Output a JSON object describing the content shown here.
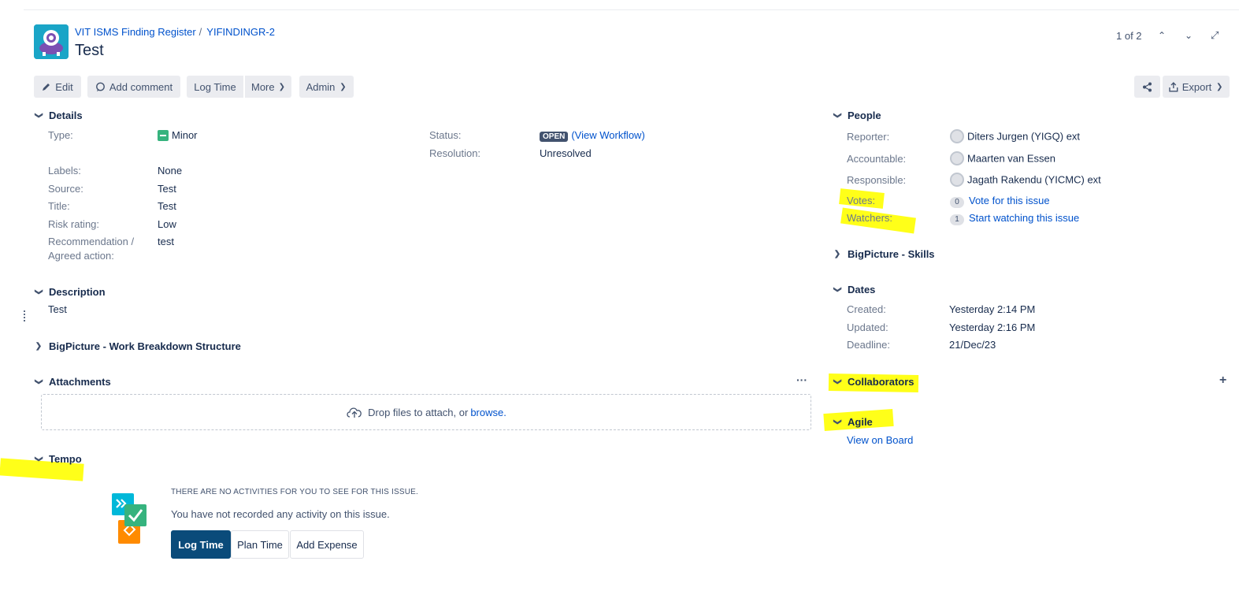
{
  "breadcrumb": {
    "project": "VIT ISMS Finding Register",
    "issue_key": "YIFINDINGR-2"
  },
  "issue": {
    "title": "Test"
  },
  "pager": {
    "text": "1 of 2"
  },
  "toolbar": {
    "edit": "Edit",
    "add_comment": "Add comment",
    "log_time": "Log Time",
    "more": "More",
    "admin": "Admin",
    "export": "Export"
  },
  "details": {
    "heading": "Details",
    "type_label": "Type:",
    "type_value": "Minor",
    "status_label": "Status:",
    "status_value": "OPEN",
    "view_workflow": "(View Workflow)",
    "resolution_label": "Resolution:",
    "resolution_value": "Unresolved",
    "labels_label": "Labels:",
    "labels_value": "None",
    "source_label": "Source:",
    "source_value": "Test",
    "title_label": "Title:",
    "title_value": "Test",
    "risk_label": "Risk rating:",
    "risk_value": "Low",
    "rec_label_1": "Recommendation /",
    "rec_label_2": "Agreed action:",
    "rec_value": "test"
  },
  "description": {
    "heading": "Description",
    "text": "Test"
  },
  "wbs": {
    "heading": "BigPicture - Work Breakdown Structure"
  },
  "attachments": {
    "heading": "Attachments",
    "more": "···",
    "drop_text": "Drop files to attach, or ",
    "browse": "browse."
  },
  "tempo": {
    "heading": "Tempo",
    "empty_title": "THERE ARE NO ACTIVITIES FOR YOU TO SEE FOR THIS ISSUE.",
    "empty_text": "You have not recorded any activity on this issue.",
    "log_time": "Log Time",
    "plan_time": "Plan Time",
    "add_expense": "Add Expense"
  },
  "people": {
    "heading": "People",
    "reporter_label": "Reporter:",
    "reporter_value": "Diters Jurgen (YIGQ) ext",
    "accountable_label": "Accountable:",
    "accountable_value": "Maarten van Essen",
    "responsible_label": "Responsible:",
    "responsible_value": "Jagath Rakendu (YICMC) ext",
    "votes_label": "Votes:",
    "votes_count": "0",
    "votes_link": "Vote for this issue",
    "watchers_label": "Watchers:",
    "watchers_count": "1",
    "watchers_link": "Start watching this issue"
  },
  "skills": {
    "heading": "BigPicture - Skills"
  },
  "dates": {
    "heading": "Dates",
    "created_label": "Created:",
    "created_value": "Yesterday 2:14 PM",
    "updated_label": "Updated:",
    "updated_value": "Yesterday 2:16 PM",
    "deadline_label": "Deadline:",
    "deadline_value": "21/Dec/23"
  },
  "collaborators": {
    "heading": "Collaborators",
    "add": "+"
  },
  "agile": {
    "heading": "Agile",
    "view_on_board": "View on Board"
  },
  "colors": {
    "highlight": "#ffff00",
    "link": "#0052cc",
    "primary_button": "#0a4b7a",
    "logo": "#1aa5c7"
  }
}
